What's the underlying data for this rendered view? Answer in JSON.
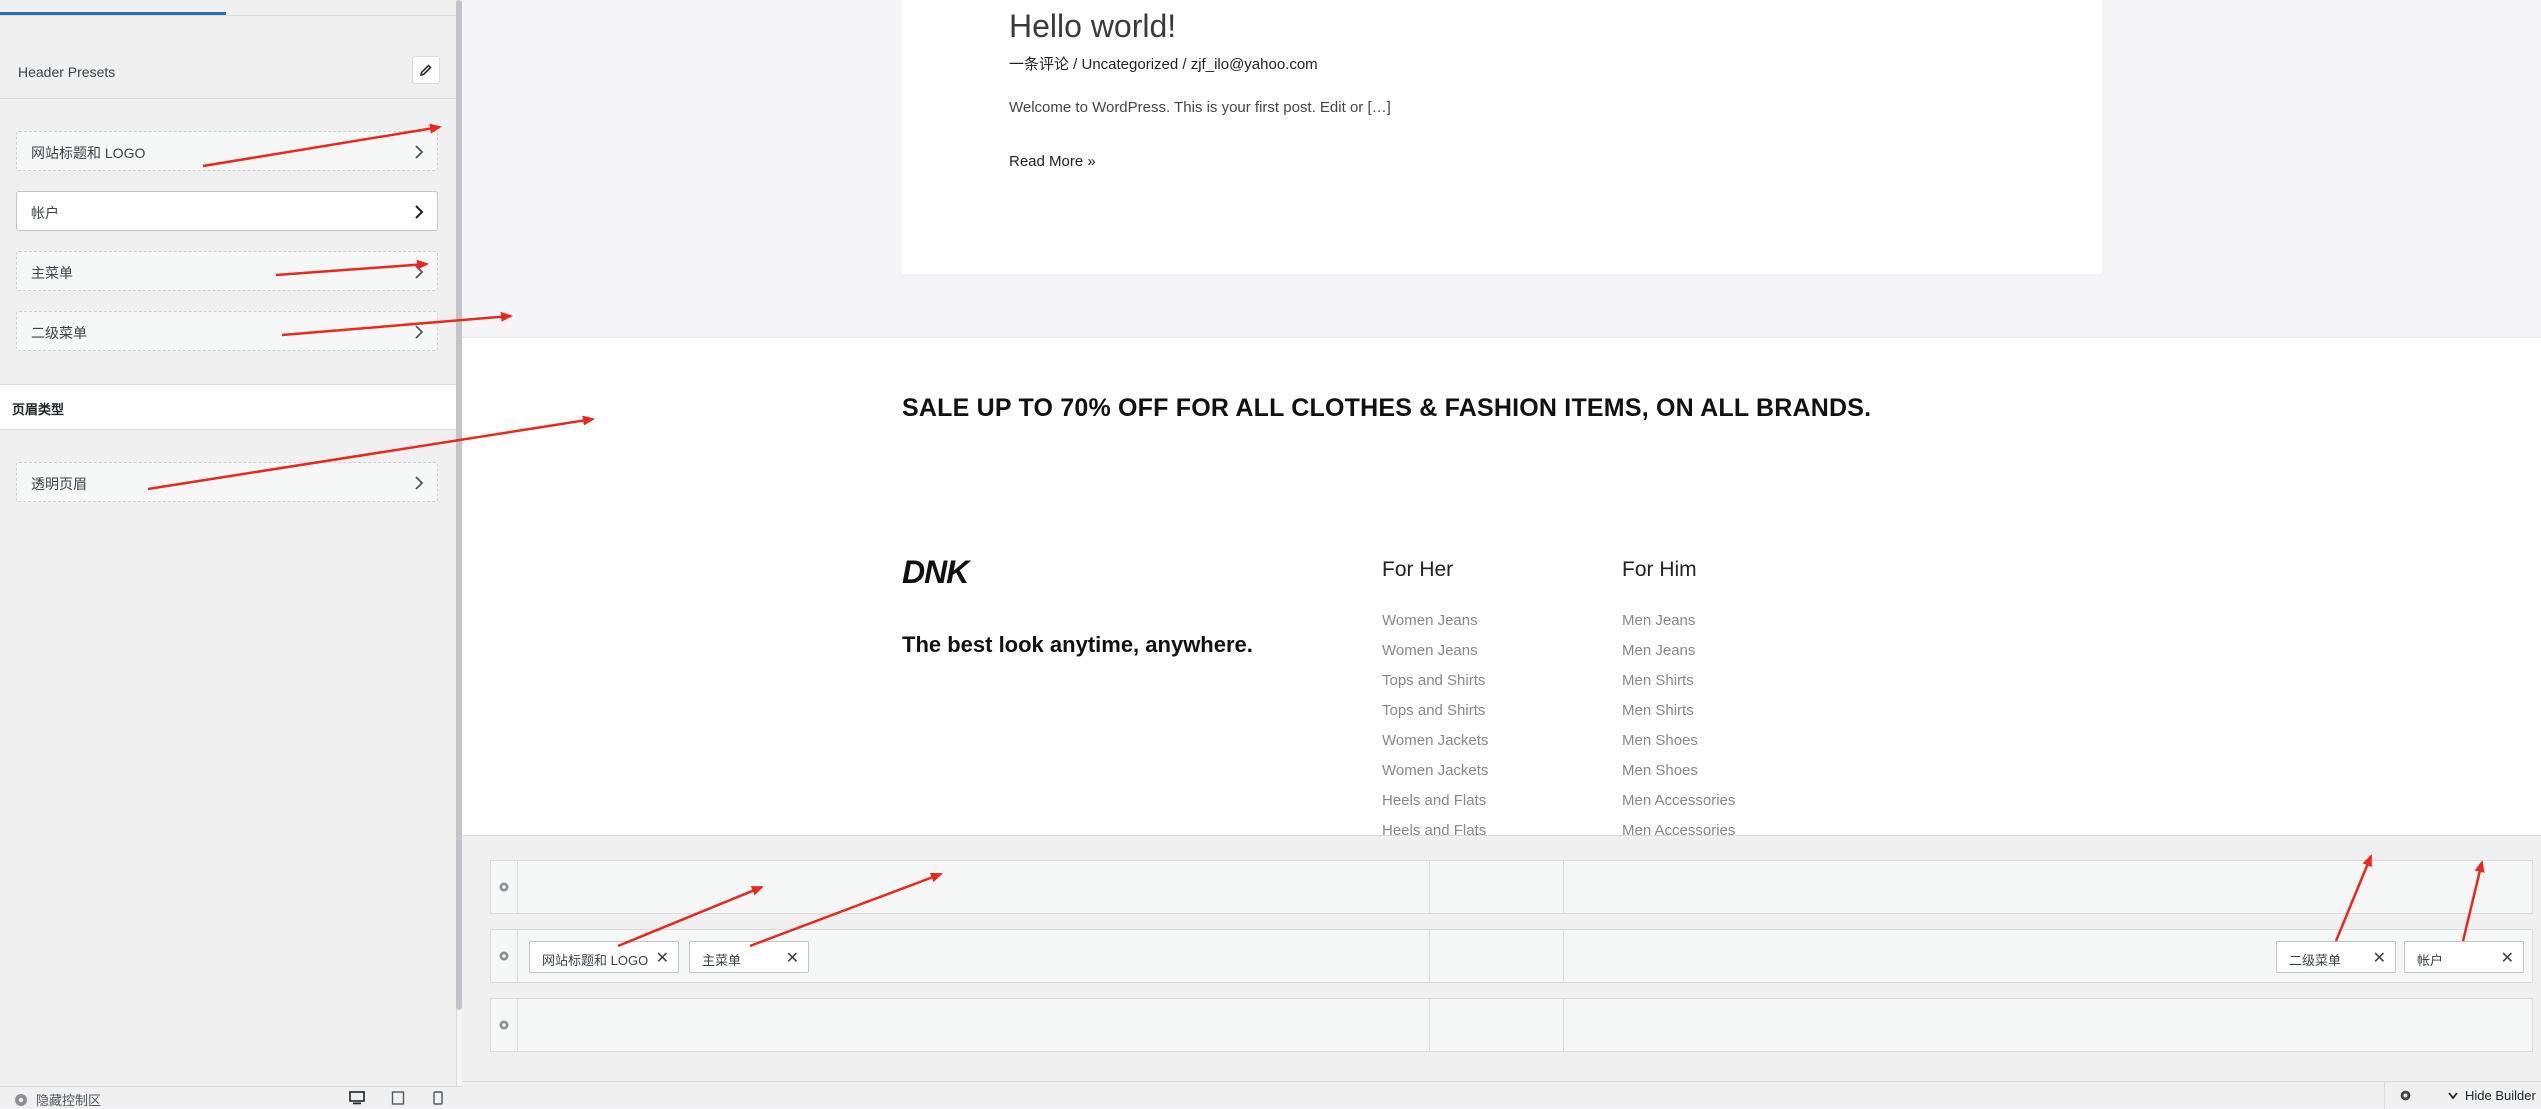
{
  "sidebar": {
    "presets_label": "Header Presets",
    "items": [
      {
        "label": "网站标题和 LOGO"
      },
      {
        "label": "帐户"
      },
      {
        "label": "主菜单"
      },
      {
        "label": "二级菜单"
      }
    ],
    "section_title": "页眉类型",
    "section_items": [
      {
        "label": "透明页眉"
      }
    ],
    "footer": {
      "collapse_label": "隐藏控制区"
    }
  },
  "post": {
    "title": "Hello world!",
    "meta": "一条评论 / Uncategorized / zjf_ilo@yahoo.com",
    "excerpt": "Welcome to WordPress. This is your first post. Edit or […]",
    "read_more": "Read More »"
  },
  "promo": {
    "text": "SALE UP TO 70% OFF FOR ALL CLOTHES & FASHION ITEMS, ON ALL BRANDS."
  },
  "footer": {
    "logo": "DNK",
    "tagline": "The best look anytime, anywhere.",
    "columns": [
      {
        "title": "For Her",
        "links": [
          "Women Jeans",
          "Women Jeans",
          "Tops and Shirts",
          "Tops and Shirts",
          "Women Jackets",
          "Women Jackets",
          "Heels and Flats",
          "Heels and Flats"
        ]
      },
      {
        "title": "For Him",
        "links": [
          "Men Jeans",
          "Men Jeans",
          "Men Shirts",
          "Men Shirts",
          "Men Shoes",
          "Men Shoes",
          "Men Accessories",
          "Men Accessories"
        ]
      }
    ]
  },
  "builder": {
    "chips": [
      {
        "label": "网站标题和 LOGO"
      },
      {
        "label": "主菜单"
      },
      {
        "label": "二级菜单"
      },
      {
        "label": "帐户"
      }
    ],
    "remove_symbol": "✕",
    "hide_label": "Hide Builder"
  },
  "colors": {
    "accent": "#2271b1",
    "annotation": "#e8291c"
  },
  "icons": [
    "pencil-icon",
    "chevron-right-icon",
    "gear-icon",
    "eye-icon",
    "desktop-icon",
    "tablet-icon",
    "mobile-icon",
    "chevron-down-icon",
    "close-icon"
  ]
}
